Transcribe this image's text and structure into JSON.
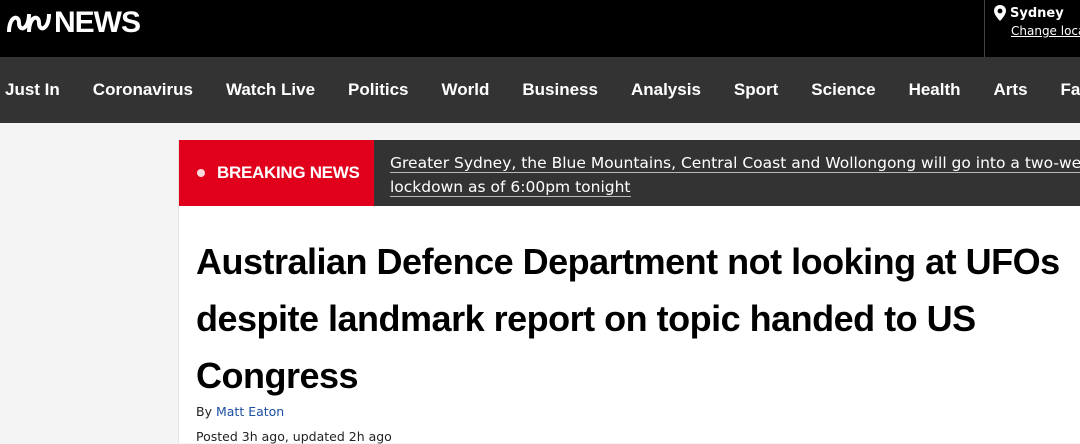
{
  "header": {
    "logo_text": "NEWS",
    "location": {
      "city": "Sydney",
      "change_label": "Change location"
    }
  },
  "nav": {
    "items": [
      "Just In",
      "Coronavirus",
      "Watch Live",
      "Politics",
      "World",
      "Business",
      "Analysis",
      "Sport",
      "Science",
      "Health",
      "Arts",
      "Fact Check"
    ]
  },
  "breaking": {
    "label": "BREAKING NEWS",
    "line1": "Greater Sydney, the Blue Mountains, Central Coast and Wollongong will go into a two-week",
    "line2": "lockdown as of 6:00pm tonight"
  },
  "article": {
    "title": "Australian Defence Department not looking at UFOs despite landmark report on topic handed to US Congress",
    "byline_prefix": "By",
    "author": "Matt Eaton",
    "posted": "Posted 3h ago, updated 2h ago"
  },
  "colors": {
    "breaking_red": "#e0001b",
    "nav_bg": "#333333",
    "header_bg": "#000000",
    "link_blue": "#1a4fa3"
  }
}
